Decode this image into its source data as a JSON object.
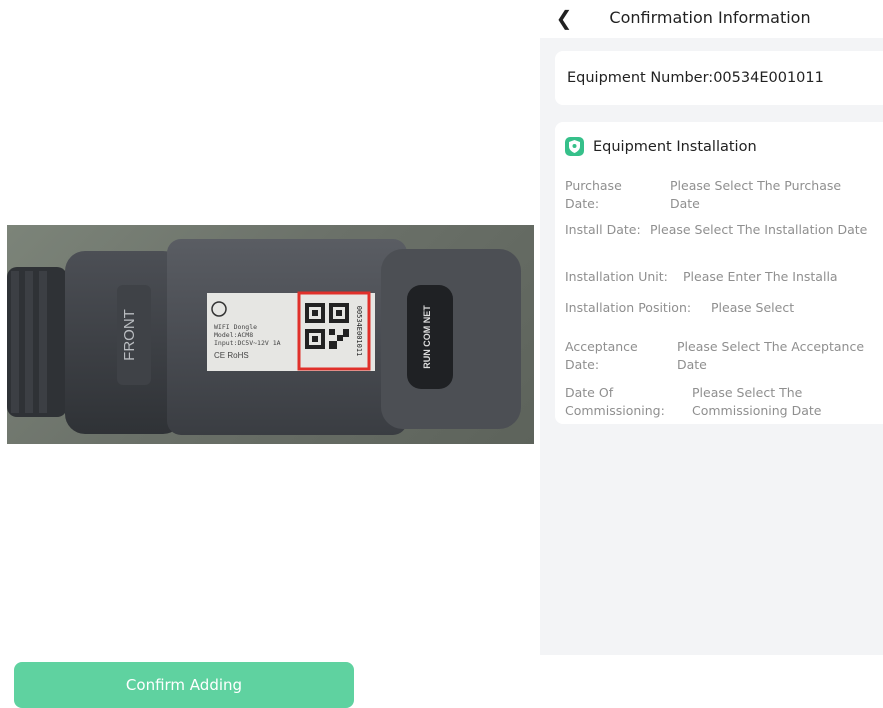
{
  "header": {
    "title": "Confirmation Information",
    "back_icon": "chevron-left-icon"
  },
  "equipment": {
    "label": "Equipment Number:",
    "number": "00534E001011"
  },
  "installation": {
    "section_title": "Equipment Installation",
    "section_icon": "shield-location-icon",
    "accent_color": "#36c08a",
    "rows": [
      {
        "label": "Purchase Date:",
        "value": "Please Select The Purchase Date"
      },
      {
        "label": "Install Date:",
        "value": "Please Select The Installation Date"
      },
      {
        "label": "Installation Unit:",
        "value": "Please Enter The Installa"
      },
      {
        "label": "Installation Position:",
        "value": "Please Select"
      },
      {
        "label": "Acceptance Date:",
        "value": "Please Select The Acceptance Date"
      },
      {
        "label": "Date Of Commissioning:",
        "value": "Please Select The Commissioning Date"
      }
    ]
  },
  "footer": {
    "confirm_label": "Confirm Adding",
    "button_color": "#5fd2a0"
  },
  "device_photo": {
    "front_text": "FRONT",
    "label_lines": [
      "WIFI Dongle",
      "Model:ACM8",
      "Input:DC5V~12V 1A"
    ],
    "cert_marks": "CE RoHS",
    "serial_text": "00534E001011",
    "indicator_text": "RUN COM NET"
  }
}
